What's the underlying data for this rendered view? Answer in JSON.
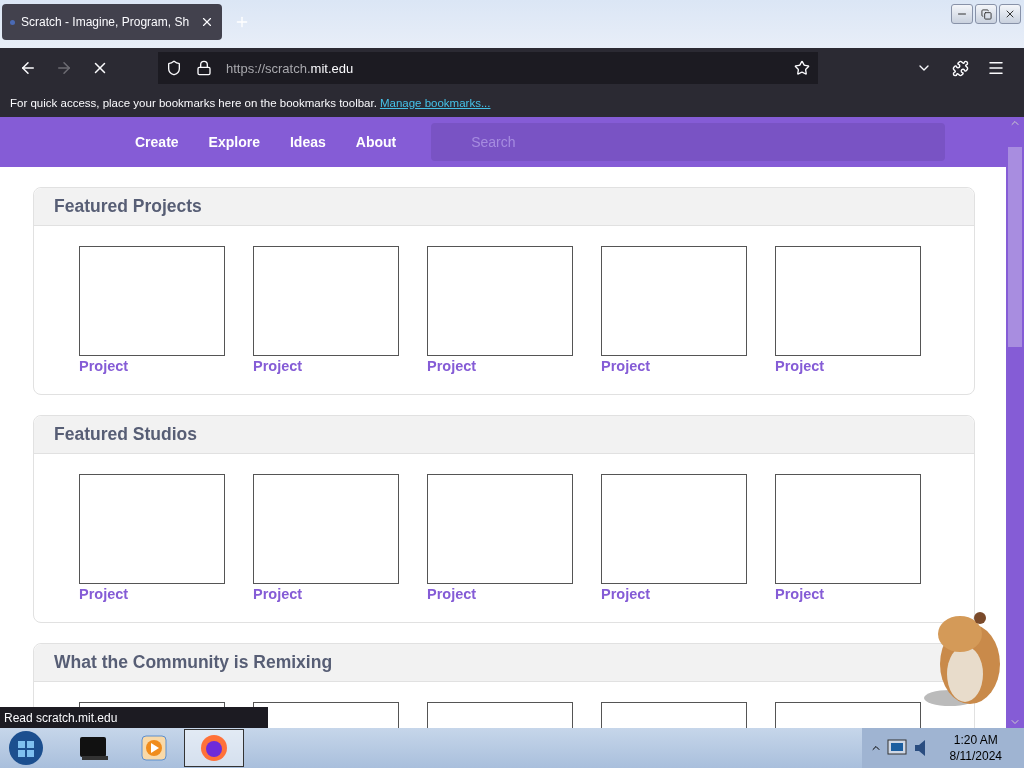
{
  "browser": {
    "tab": {
      "title": "Scratch - Imagine, Program, Sh",
      "selected": true
    },
    "url_host": "https://scratch.",
    "url_domain": "mit.edu",
    "loading": true,
    "bookmarks_hint": "For quick access, place your bookmarks here on the bookmarks toolbar.",
    "bookmarks_link": "Manage bookmarks..."
  },
  "nav": {
    "items": [
      "Create",
      "Explore",
      "Ideas",
      "About"
    ],
    "search": {
      "placeholder": "Search"
    }
  },
  "sections": [
    {
      "title": "Featured Projects",
      "items": [
        {
          "kind": "card",
          "label": "Project"
        },
        {
          "kind": "card",
          "label": "Project"
        },
        {
          "kind": "card",
          "label": "Project"
        },
        {
          "kind": "card",
          "label": "Project"
        },
        {
          "kind": "card",
          "label": "Project"
        }
      ]
    },
    {
      "title": "Featured Studios",
      "items": [
        {
          "kind": "card",
          "label": "Project"
        },
        {
          "kind": "card",
          "label": "Project"
        },
        {
          "kind": "card",
          "label": "Project"
        },
        {
          "kind": "card",
          "label": "Project"
        },
        {
          "kind": "card",
          "label": "Project"
        }
      ]
    },
    {
      "title": "What the Community is Remixing",
      "items": [
        {
          "kind": "frame"
        },
        {
          "kind": "frame"
        },
        {
          "kind": "frame"
        },
        {
          "kind": "frame"
        },
        {
          "kind": "frame"
        }
      ]
    }
  ],
  "status_text": "Read scratch.mit.edu",
  "taskbar": {
    "apps": [
      {
        "kind": "terminal",
        "selected": false
      },
      {
        "kind": "media",
        "selected": false
      },
      {
        "kind": "browser",
        "selected": true
      }
    ],
    "time": "1:20 AM",
    "date": "8/11/2024"
  }
}
